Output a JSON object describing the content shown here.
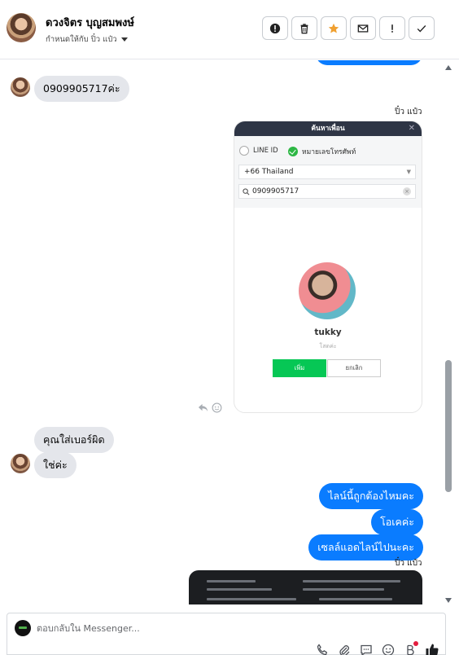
{
  "header": {
    "contact_name": "ดวงจิตร บุญสมพงษ์",
    "assigned_to": "กำหนดให้กับ ปิ๋ว แป๋ว"
  },
  "toolbar": {
    "icons": [
      "alert-circle-icon",
      "trash-icon",
      "star-icon",
      "envelope-icon",
      "exclamation-icon",
      "check-icon"
    ],
    "accent": "#f0a030"
  },
  "messages": {
    "phone_in": "0909905717ค่ะ",
    "sender_1": "ปิ๋ว แป๋ว",
    "wrong_number": "คุณใส่เบอร์ผิด",
    "yes": "ใช่ค่ะ",
    "out_1": "ไลน์นี้ถูกต้องไหมคะ",
    "out_2": "โอเคค่ะ",
    "out_3": "เซลล์แอดไลน์ไปนะคะ",
    "sender_2": "ปิ๋ว แป๋ว"
  },
  "line_card": {
    "title": "ค้นหาเพื่อน",
    "radio_line_id": "LINE ID",
    "radio_phone": "หมายเลขโทรศัพท์",
    "country": "+66  Thailand",
    "search_value": "0909905717",
    "profile_name": "tukky",
    "profile_sub": "โสดค่ะ",
    "add_label": "เพิ่ม",
    "cancel_label": "ยกเลิก"
  },
  "composer": {
    "placeholder": "ตอบกลับใน Messenger..."
  },
  "colors": {
    "outgoing_bubble": "#0a7cff",
    "incoming_bubble": "#e4e6eb",
    "line_green": "#06c755"
  }
}
